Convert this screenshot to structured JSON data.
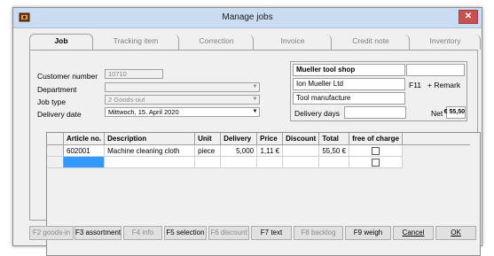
{
  "window": {
    "title": "Manage jobs",
    "close_label": "✕"
  },
  "tabs": [
    {
      "label": "Job",
      "active": true
    },
    {
      "label": "Tracking item",
      "active": false
    },
    {
      "label": "Correction",
      "active": false
    },
    {
      "label": "Invoice",
      "active": false
    },
    {
      "label": "Credit note",
      "active": false
    },
    {
      "label": "Inventory",
      "active": false
    }
  ],
  "form": {
    "customer_number_label": "Customer number",
    "customer_number_value": "10710",
    "department_label": "Department",
    "department_value": "",
    "job_type_label": "Job type",
    "job_type_value": "2  Goods-out",
    "delivery_date_label": "Delivery date",
    "delivery_date_value": "Mittwoch, 15. April 2020"
  },
  "customer": {
    "name": "Mueller tool shop",
    "contact": "Ion Mueller Ltd",
    "line3": "Tool manufacture",
    "f11_label": "F11",
    "remark_label": "+ Remark",
    "delivery_days_label": "Delivery days",
    "net_label": "Net",
    "net_value": "55,50 €"
  },
  "grid": {
    "headers": [
      "Article no.",
      "Description",
      "Unit",
      "Delivery",
      "Price",
      "Discount",
      "Total",
      "free of charge"
    ],
    "rows": [
      {
        "article": "602001",
        "description": "Machine cleaning cloth",
        "unit": "piece",
        "delivery": "5,000",
        "price": "1,11 €",
        "discount": "",
        "total": "55,50 €"
      }
    ]
  },
  "buttons": [
    {
      "label": "F2 goods-in",
      "enabled": false
    },
    {
      "label": "F3 assortment",
      "enabled": true
    },
    {
      "label": "F4 info",
      "enabled": false
    },
    {
      "label": "F5 selection",
      "enabled": true
    },
    {
      "label": "F6 discount",
      "enabled": false
    },
    {
      "label": "F7 text",
      "enabled": true
    },
    {
      "label": "F8 backlog",
      "enabled": false
    },
    {
      "label": "F9 weigh",
      "enabled": true
    },
    {
      "label": "Cancel",
      "enabled": true
    },
    {
      "label": "OK",
      "enabled": true
    }
  ]
}
